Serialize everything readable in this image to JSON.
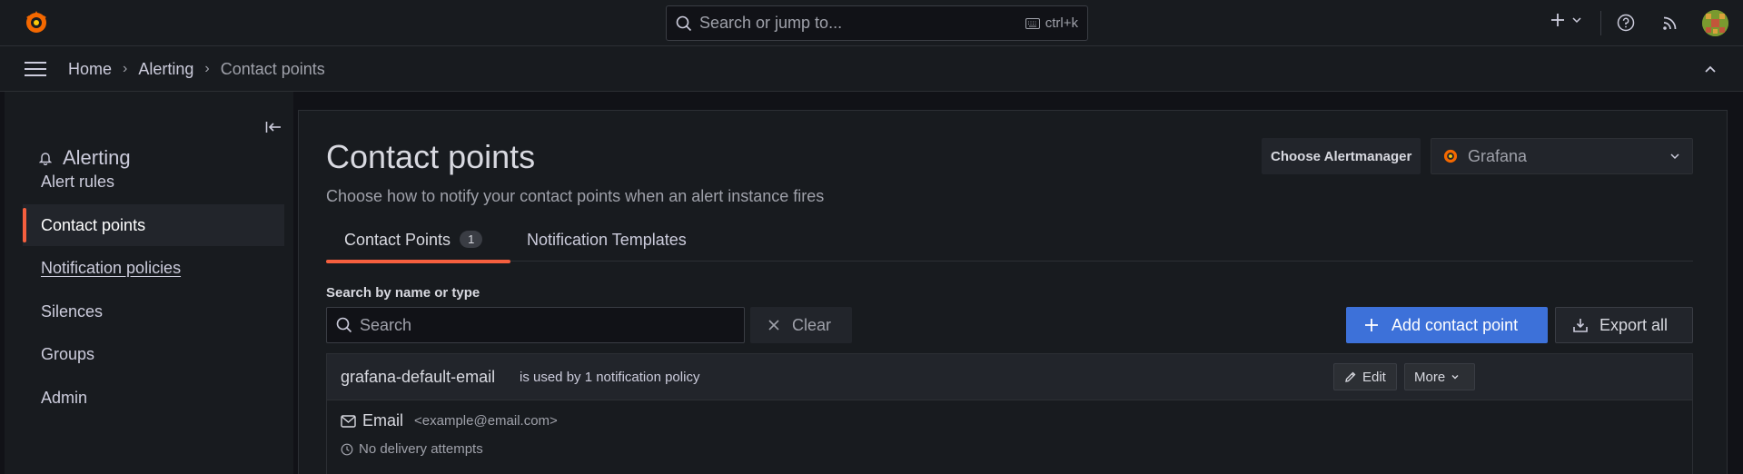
{
  "topbar": {
    "search_placeholder": "Search or jump to...",
    "search_shortcut": "ctrl+k"
  },
  "breadcrumb": {
    "items": [
      "Home",
      "Alerting",
      "Contact points"
    ],
    "separator": "›"
  },
  "sidebar": {
    "title": "Alerting",
    "items": [
      {
        "label": "Alert rules"
      },
      {
        "label": "Contact points"
      },
      {
        "label": "Notification policies"
      },
      {
        "label": "Silences"
      },
      {
        "label": "Groups"
      },
      {
        "label": "Admin"
      }
    ]
  },
  "page": {
    "title": "Contact points",
    "subtitle": "Choose how to notify your contact points when an alert instance fires",
    "alertmanager_label": "Choose Alertmanager",
    "alertmanager_value": "Grafana",
    "tabs": [
      {
        "label": "Contact Points",
        "count": "1"
      },
      {
        "label": "Notification Templates"
      }
    ],
    "search_label": "Search by name or type",
    "search_placeholder": "Search",
    "clear_label": "Clear",
    "add_label": "Add contact point",
    "export_label": "Export all"
  },
  "contact_points": [
    {
      "name": "grafana-default-email",
      "usage": "is used by 1 notification policy",
      "edit_label": "Edit",
      "more_label": "More",
      "integration_type": "Email",
      "integration_address": "<example@email.com>",
      "delivery_status": "No delivery attempts"
    }
  ],
  "colors": {
    "accent": "#f55f3e",
    "primary": "#3d71d9",
    "background": "#111217",
    "panel": "#181b1f"
  }
}
